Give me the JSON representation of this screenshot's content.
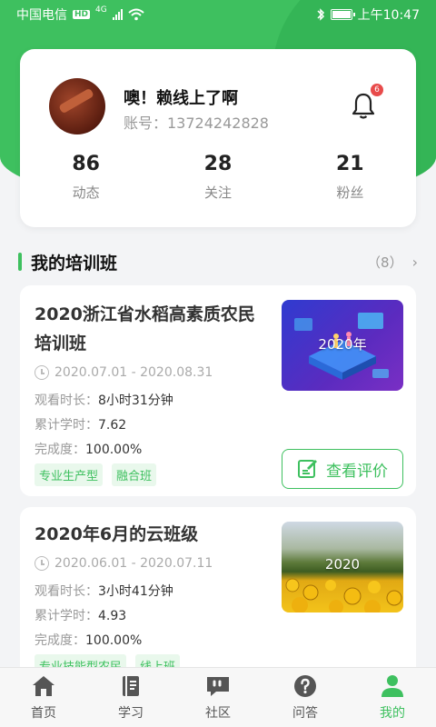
{
  "status_bar": {
    "carrier": "中国电信",
    "hd": "HD",
    "network": "4G",
    "time": "上午10:47"
  },
  "profile": {
    "nickname": "噢！赖线上了啊",
    "account": "账号：13724242828",
    "notification_count": "6",
    "stats": [
      {
        "value": "86",
        "label": "动态"
      },
      {
        "value": "28",
        "label": "关注"
      },
      {
        "value": "21",
        "label": "粉丝"
      }
    ]
  },
  "section": {
    "title": "我的培训班",
    "count": "（8）",
    "arrow": "›"
  },
  "courses": [
    {
      "title": "2020浙江省水稻高素质农民培训班",
      "thumb_label": "2020年",
      "date_range": "2020.07.01 - 2020.08.31",
      "watch_label": "观看时长：",
      "watch_value": "8小时31分钟",
      "hours_label": "累计学时：",
      "hours_value": "7.62",
      "completion_label": "完成度：",
      "completion_value": "100.00%",
      "tags": [
        "专业生产型",
        "融合班"
      ],
      "review_button": "查看评价"
    },
    {
      "title": "2020年6月的云班级",
      "thumb_label": "2020",
      "date_range": "2020.06.01 - 2020.07.11",
      "watch_label": "观看时长：",
      "watch_value": "3小时41分钟",
      "hours_label": "累计学时：",
      "hours_value": "4.93",
      "completion_label": "完成度：",
      "completion_value": "100.00%",
      "tags": [
        "专业技能型农民",
        "线上班"
      ]
    }
  ],
  "bottom_nav": [
    {
      "label": "首页",
      "icon": "home-icon"
    },
    {
      "label": "学习",
      "icon": "book-icon"
    },
    {
      "label": "社区",
      "icon": "chat-quote-icon"
    },
    {
      "label": "问答",
      "icon": "question-icon"
    },
    {
      "label": "我的",
      "icon": "user-icon",
      "active": true
    }
  ],
  "colors": {
    "accent": "#3ec05f",
    "badge": "#e84b4b"
  }
}
